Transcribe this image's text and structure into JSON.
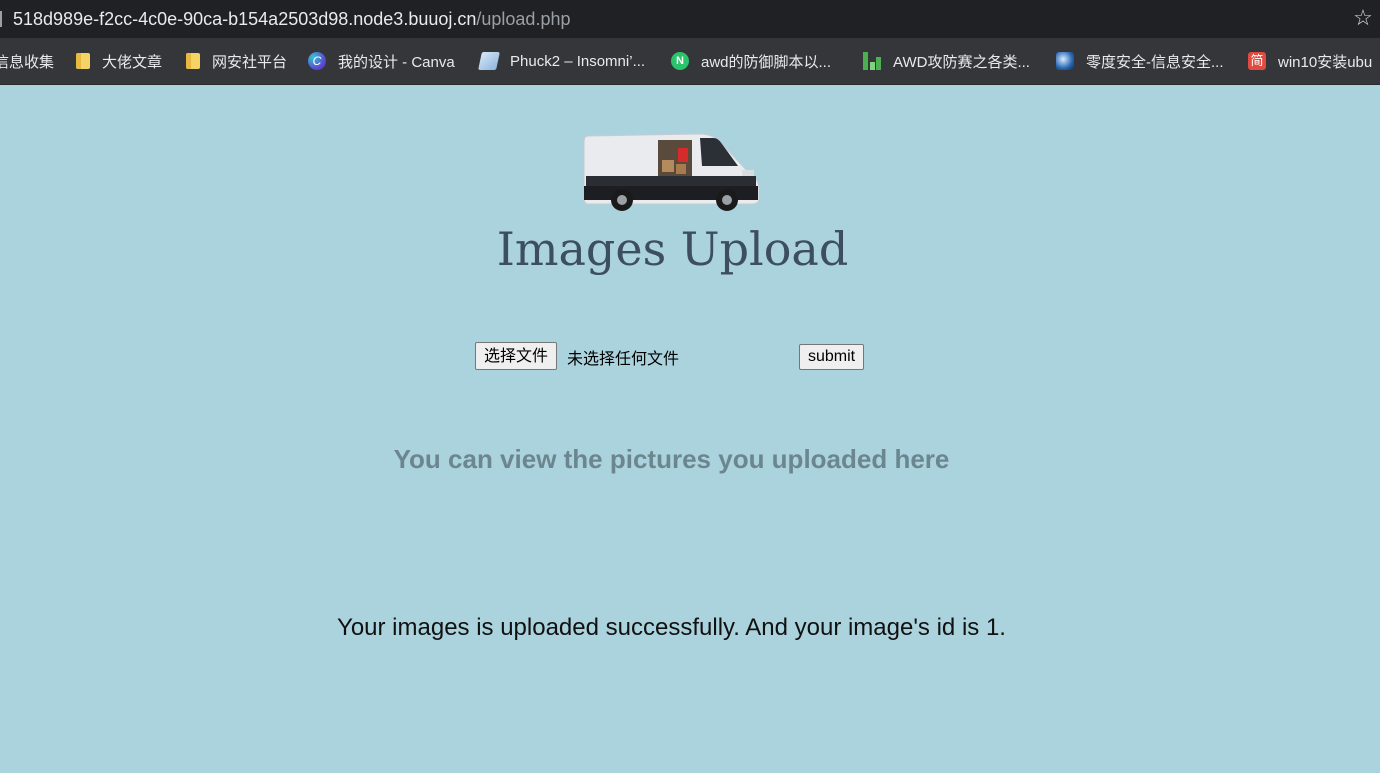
{
  "browser": {
    "url_host": "518d989e-f2cc-4c0e-90ca-b154a2503d98.node3.buuoj.cn",
    "url_path": "/upload.php",
    "bookmarks": [
      {
        "label": "信息收集",
        "icon": "folder-icon"
      },
      {
        "label": "大佬文章",
        "icon": "folder-icon"
      },
      {
        "label": "网安社平台",
        "icon": "folder-icon"
      },
      {
        "label": "我的设计 - Canva",
        "icon": "canva-icon"
      },
      {
        "label": "Phuck2 – Insomni’...",
        "icon": "document-icon"
      },
      {
        "label": "awd的防御脚本以...",
        "icon": "n-logo-icon"
      },
      {
        "label": "AWD攻防赛之各类...",
        "icon": "bar-logo-icon"
      },
      {
        "label": "零度安全-信息安全...",
        "icon": "globe-icon"
      },
      {
        "label": "win10安装ubu",
        "icon": "jian-icon",
        "icon_text": "简"
      }
    ]
  },
  "page": {
    "title": "Images Upload",
    "choose_file_label": "选择文件",
    "no_file_text": "未选择任何文件",
    "submit_label": "submit",
    "view_hint": "You can view the pictures you uploaded here",
    "success_message": "Your images is uploaded successfully. And your image's id is 1."
  },
  "colors": {
    "page_background": "#abd3de",
    "title": "#3d4e61",
    "hint": "#6c868f"
  }
}
